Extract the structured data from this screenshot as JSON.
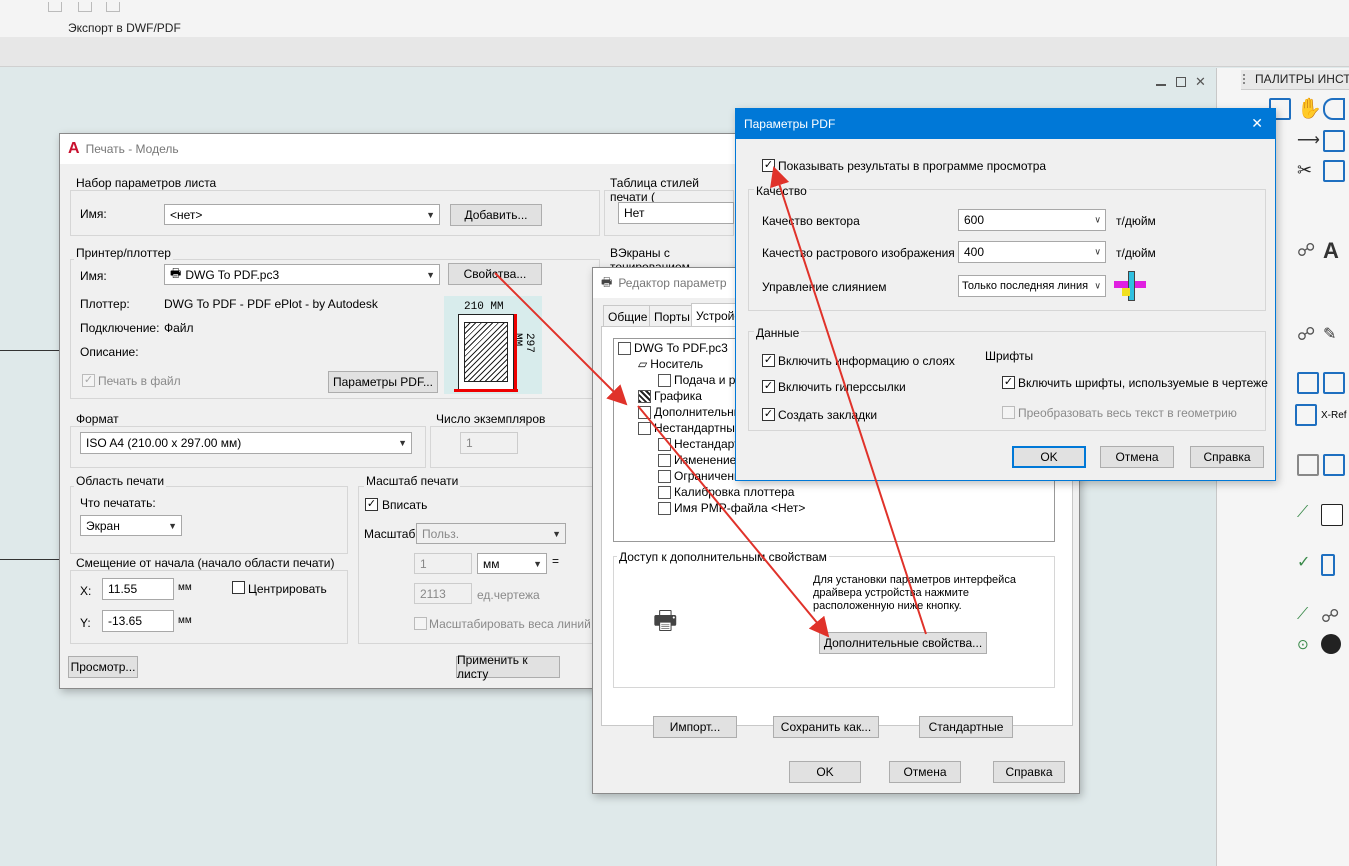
{
  "app": {
    "ribbon_label": "Экспорт в DWF/PDF",
    "palette_title": "ПАЛИТРЫ ИНСТР"
  },
  "print_dialog": {
    "title": "Печать - Модель",
    "page_setup": {
      "group": "Набор параметров листа",
      "name_label": "Имя:",
      "name_value": "<нет>",
      "add_button": "Добавить..."
    },
    "plot_style": {
      "group": "Таблица стилей печати (",
      "value": "Нет"
    },
    "shaded": {
      "group": "ВЭкраны с тонированием"
    },
    "printer": {
      "group": "Принтер/плоттер",
      "name_label": "Имя:",
      "name_value": "DWG To PDF.pc3",
      "properties_button": "Свойства...",
      "plotter_label": "Плоттер:",
      "plotter_value": "DWG To PDF - PDF ePlot - by Autodesk",
      "connection_label": "Подключение:",
      "connection_value": "Файл",
      "description_label": "Описание:",
      "print_to_file": "Печать в файл",
      "pdf_params_button": "Параметры PDF...",
      "preview_width": "210 MM",
      "preview_height": "297 MM"
    },
    "format": {
      "group": "Формат",
      "value": "ISO A4 (210.00 x 297.00 мм)"
    },
    "copies": {
      "group": "Число экземпляров",
      "value": "1"
    },
    "area": {
      "group": "Область печати",
      "what_label": "Что печатать:",
      "what_value": "Экран"
    },
    "scale": {
      "group": "Масштаб печати",
      "fit_label": "Вписать",
      "scale_label": "Масштаб:",
      "scale_value": "Польз.",
      "val1": "1",
      "unit1": "мм",
      "eq": "=",
      "val2": "2113",
      "unit2": "ед.чертежа",
      "lineweights": "Масштабировать веса линий"
    },
    "offset": {
      "group": "Смещение от начала (начало области печати)",
      "x_label": "X:",
      "x_value": "11.55",
      "y_label": "Y:",
      "y_value": "-13.65",
      "unit": "мм",
      "center_label": "Центрировать"
    },
    "preview_button": "Просмотр...",
    "apply_button": "Применить к листу"
  },
  "param_editor": {
    "title": "Редактор параметр",
    "tabs": [
      "Общие",
      "Порты",
      "Устройс"
    ],
    "tree": [
      "DWG To PDF.pc3",
      "Носитель",
      "Подача и ра",
      "Графика",
      "Дополнительны",
      "Нестандартны",
      "Нестандарт",
      "Изменение",
      "Ограничени",
      "Калибровка плоттера",
      "Имя PMP-файла <Нет>"
    ],
    "access_group": "Доступ к дополнительным свойствам",
    "access_text": "Для установки параметров интерфейса драйвера устройства нажмите расположенную ниже кнопку.",
    "advanced_button": "Дополнительные свойства...",
    "import_button": "Импорт...",
    "save_button": "Сохранить как...",
    "default_button": "Стандартные",
    "ok": "OK",
    "cancel": "Отмена",
    "help": "Справка"
  },
  "pdf_dialog": {
    "title": "Параметры PDF",
    "show_results": "Показывать результаты в программе просмотра",
    "quality_group": "Качество",
    "vector_label": "Качество вектора",
    "vector_value": "600",
    "vector_unit": "т/дюйм",
    "raster_label": "Качество растрового изображения",
    "raster_value": "400",
    "raster_unit": "т/дюйм",
    "merge_label": "Управление слиянием",
    "merge_value": "Только последняя линия",
    "data_group": "Данные",
    "layers": "Включить информацию о слоях",
    "hyperlinks": "Включить гиперссылки",
    "bookmarks": "Создать закладки",
    "fonts_label": "Шрифты",
    "embed_fonts": "Включить шрифты, используемые в чертеже",
    "convert_text": "Преобразовать весь текст в геометрию",
    "ok": "OK",
    "cancel": "Отмена",
    "help": "Справка"
  },
  "colors": {
    "accent": "#0078d7",
    "arrow": "#e0322a"
  }
}
